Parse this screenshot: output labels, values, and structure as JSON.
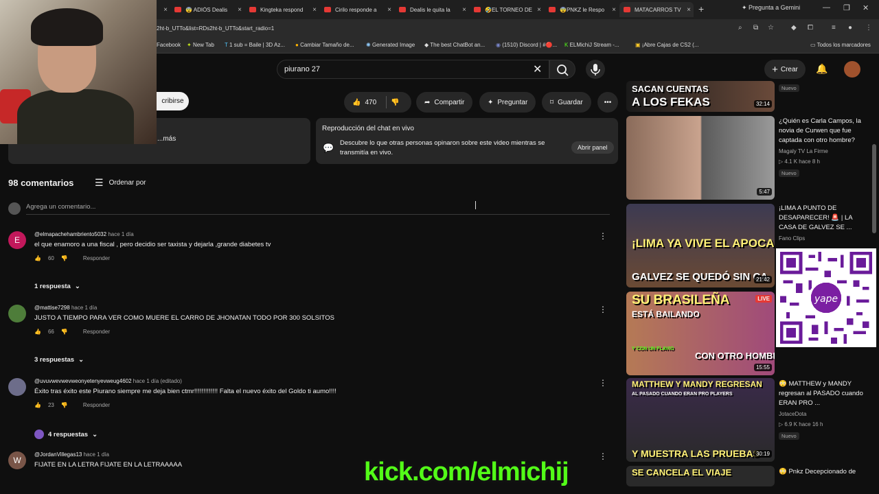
{
  "browser": {
    "tabs": [
      {
        "title": ""
      },
      {
        "title": "😨 ADIÓS Dealis"
      },
      {
        "title": "Kingteka respond"
      },
      {
        "title": "Cirilo responde a"
      },
      {
        "title": "Dealis le quita la"
      },
      {
        "title": "🤣EL TORNEO DE"
      },
      {
        "title": "😨PNKZ le Respo"
      },
      {
        "title": "MATACARROS TV"
      }
    ],
    "new_tab": "+",
    "gemini": "Pregunta a Gemini",
    "url": "2ht-b_UTTo&list=RDs2ht-b_UTTo&start_radio=1",
    "bookmarks": [
      "Facebook",
      "New Tab",
      "1 sub = Baile | 3D Az...",
      "Cambiar Tamaño de...",
      "Generated Image",
      "The best ChatBot an...",
      "(1510) Discord | #🔴...",
      "ELMichiJ Stream -...",
      "¡Abre Cajas de CS2 (..."
    ],
    "bookmarks_folder": "Todos los marcadores"
  },
  "youtube": {
    "search_value": "piurano 27",
    "create_label": "Crear",
    "subscribe_label": "cribirse",
    "likes": "470",
    "share_label": "Compartir",
    "ask_label": "Preguntar",
    "save_label": "Guardar",
    "desc_more": "...más",
    "chat_replay": {
      "title": "Reproducción del chat en vivo",
      "body": "Descubre lo que otras personas opinaron sobre este video mientras se transmitía en vivo.",
      "button": "Abrir panel"
    },
    "comments_count": "98 comentarios",
    "order_label": "Ordenar por",
    "add_comment_placeholder": "Agrega un comentario...",
    "comments": [
      {
        "initial": "E",
        "user": "@elmapachehambriento5032",
        "time": "hace 1 día",
        "text": "el que enamoro a una fiscal , pero decidio ser taxista y dejarla ,grande diabetes tv",
        "likes": "60",
        "reply_label": "Responder",
        "replies": "1 respuesta",
        "avatar_color": "#c2185b"
      },
      {
        "initial": "",
        "user": "@mattise7298",
        "time": "hace 1 día",
        "text": "JUSTO A TIEMPO PARA VER COMO MUERE EL CARRO DE JHONATAN TODO POR 300 SOLSITOS",
        "likes": "66",
        "reply_label": "Responder",
        "replies": "3 respuestas",
        "avatar_color": "#4e7d3a"
      },
      {
        "initial": "",
        "user": "@uvuvwevwevweonyetenyevweug4602",
        "time": "hace 1 día (editado)",
        "text": "Éxito tras éxito este Piurano siempre me deja bien ctmr!!!!!!!!!!!!! Falta el nuevo éxito del Goldo ti aumo!!!!",
        "likes": "23",
        "reply_label": "Responder",
        "replies": "4 respuestas",
        "avatar_color": "#6d6d8a"
      },
      {
        "initial": "W",
        "user": "@JordanVillegas13",
        "time": "hace 1 día",
        "text": "FIJATE EN LA LETRA FIJATE EN LA LETRAAAAA",
        "likes": "",
        "reply_label": "",
        "replies": "",
        "avatar_color": "#795548"
      }
    ],
    "related": [
      {
        "overlay": "A LOS FEKAS",
        "overlay2": "SACAN CUENTAS",
        "duration": "32:14",
        "title": "",
        "channel": "",
        "meta": "",
        "badge": "Nuevo"
      },
      {
        "overlay": "",
        "overlay2": "",
        "duration": "5:47",
        "title": "¿Quién es Carla Campos, la novia de Curwen que fue captada con otro hombre?",
        "channel": "Magaly TV La Firme",
        "meta": "▷ 4.1 K   hace 8 h",
        "badge": "Nuevo"
      },
      {
        "overlay": "GALVEZ SE QUEDÓ SIN CA",
        "overlay2": "¡LIMA YA VIVE EL APOCALIPSIS!",
        "duration": "21:42",
        "title": "¡LIMA A PUNTO DE DESAPARECER! 🚨 | LA CASA DE GALVEZ SE ...",
        "channel": "Fano Clips",
        "meta": "",
        "badge": ""
      },
      {
        "overlay": "SU BRASILEÑA",
        "overlay2": "ESTÁ BAILANDO",
        "duration": "15:55",
        "title": "",
        "channel": "",
        "meta": "",
        "badge": "",
        "live": "LIVE",
        "extra": "CON OTRO HOMBRE",
        "extra2": "Y CON UN FLAVIO"
      },
      {
        "overlay": "MATTHEW Y MANDY REGRESAN",
        "overlay2": "AL PASADO CUANDO ERAN PRO PLAYERS",
        "duration": "30:19",
        "title": "😳 MATTHEW y MANDY regresan al PASADO cuando ERAN PRO ...",
        "channel": "JotaceDota",
        "meta": "▷ 6.9 K   hace 16 h",
        "badge": "Nuevo",
        "extra": "Y MUESTRA LAS PRUEBAS"
      },
      {
        "overlay": "SE CANCELA EL VIAJE",
        "overlay2": "",
        "duration": "",
        "title": "😳 Pnkz Decepcionado de",
        "channel": "",
        "meta": "",
        "badge": ""
      }
    ]
  },
  "overlay": {
    "kick": "kick.com/elmichij"
  },
  "colors": {
    "youtube_red": "#ff0000",
    "kick_green": "#53fc18",
    "bg": "#0f0f0f"
  }
}
